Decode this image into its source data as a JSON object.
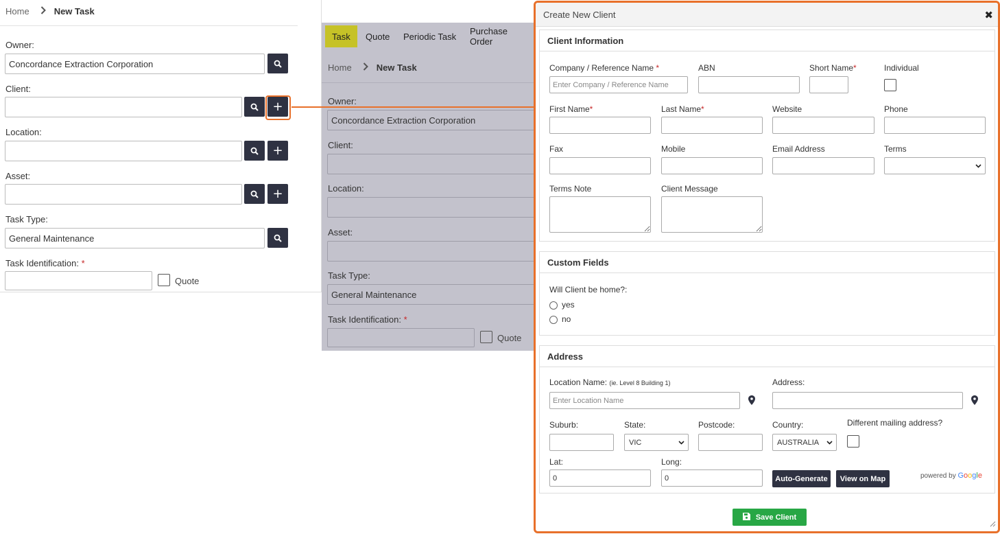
{
  "left_form": {
    "breadcrumb": {
      "home": "Home",
      "current": "New Task"
    },
    "owner": {
      "label": "Owner:",
      "value": "Concordance Extraction Corporation"
    },
    "client": {
      "label": "Client:",
      "value": ""
    },
    "location": {
      "label": "Location:",
      "value": ""
    },
    "asset": {
      "label": "Asset:",
      "value": ""
    },
    "task_type": {
      "label": "Task Type:",
      "value": "General Maintenance"
    },
    "task_identification": {
      "label": "Task Identification:",
      "required_mark": "*",
      "value": ""
    },
    "quote_label": "Quote",
    "plus_symbol": "+"
  },
  "background_form": {
    "tabs": [
      "Task",
      "Quote",
      "Periodic Task",
      "Purchase Order"
    ],
    "active_tab": "Task",
    "breadcrumb": {
      "home": "Home",
      "current": "New Task"
    },
    "owner": {
      "label": "Owner:",
      "value": "Concordance Extraction Corporation"
    },
    "client": {
      "label": "Client:"
    },
    "location": {
      "label": "Location:"
    },
    "asset": {
      "label": "Asset:"
    },
    "task_type": {
      "label": "Task Type:",
      "value": "General Maintenance"
    },
    "task_identification": {
      "label": "Task Identification:",
      "required_mark": "*"
    },
    "quote_label": "Quote"
  },
  "modal": {
    "title": "Create New Client",
    "close_symbol": "✖",
    "client_information": {
      "title": "Client Information",
      "company_label": "Company / Reference Name",
      "company_required": "*",
      "company_placeholder": "Enter Company / Reference Name",
      "abn_label": "ABN",
      "short_name_label": "Short Name",
      "short_name_required": "*",
      "individual_label": "Individual",
      "first_name_label": "First Name",
      "first_name_required": "*",
      "last_name_label": "Last Name",
      "last_name_required": "*",
      "website_label": "Website",
      "phone_label": "Phone",
      "fax_label": "Fax",
      "mobile_label": "Mobile",
      "email_label": "Email Address",
      "terms_label": "Terms",
      "terms_value": "",
      "terms_note_label": "Terms Note",
      "client_message_label": "Client Message"
    },
    "custom_fields": {
      "title": "Custom Fields",
      "question": "Will Client be home?:",
      "options": [
        "yes",
        "no"
      ]
    },
    "address": {
      "title": "Address",
      "location_name_label": "Location Name:",
      "location_name_hint": "(ie. Level 8 Building 1)",
      "location_name_placeholder": "Enter Location Name",
      "address_label": "Address:",
      "suburb_label": "Suburb:",
      "state_label": "State:",
      "state_value": "VIC",
      "postcode_label": "Postcode:",
      "country_label": "Country:",
      "country_value": "AUSTRALIA",
      "mailing_label": "Different mailing address?",
      "lat_label": "Lat:",
      "lat_value": "0",
      "long_label": "Long:",
      "long_value": "0",
      "auto_generate_label": "Auto-Generate",
      "view_map_label": "View on Map",
      "powered_by": "powered by",
      "google": {
        "g1": "G",
        "g2": "o",
        "g3": "o",
        "g4": "g",
        "g5": "l",
        "g6": "e"
      }
    },
    "save_label": "Save Client"
  },
  "colors": {
    "highlight": "#e8702a",
    "dark_button": "#2f3242",
    "active_tab": "#c6c227",
    "save_button": "#28a745",
    "required": "#c62828"
  }
}
